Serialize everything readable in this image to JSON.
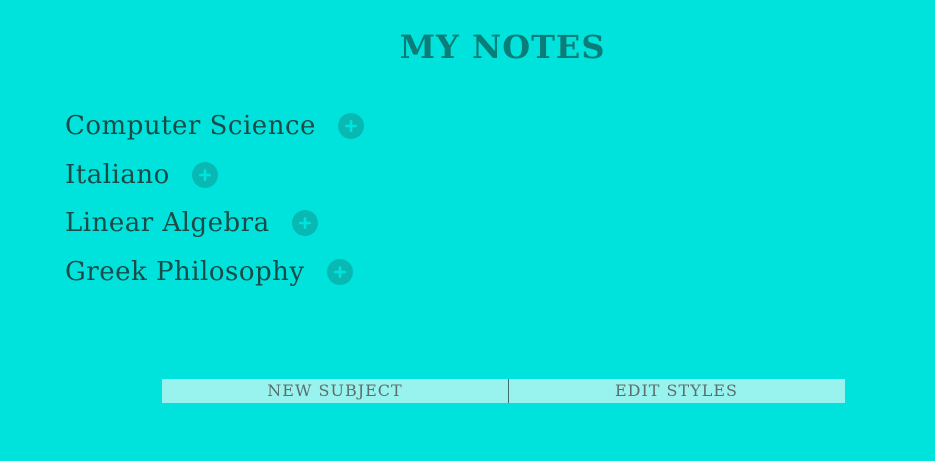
{
  "page": {
    "title": "MY NOTES"
  },
  "subjects": [
    {
      "name": "Computer Science"
    },
    {
      "name": "Italiano"
    },
    {
      "name": "Linear Algebra"
    },
    {
      "name": "Greek Philosophy"
    }
  ],
  "actions": {
    "new_subject_label": "NEW SUBJECT",
    "edit_styles_label": "EDIT STYLES"
  },
  "icons": {
    "add": "plus-circle-icon"
  },
  "colors": {
    "background": "#00e3dc",
    "title": "#0b7d79",
    "subject_text": "#1b4b48",
    "add_icon_fill": "#08b9b3",
    "action_bar_bg": "#98f3ee",
    "action_text": "#5a6f6d"
  }
}
